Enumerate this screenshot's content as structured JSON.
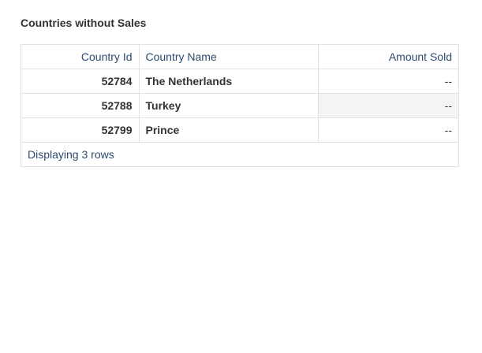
{
  "report": {
    "title": "Countries without Sales",
    "columns": {
      "country_id": "Country Id",
      "country_name": "Country Name",
      "amount_sold": "Amount Sold"
    },
    "rows": [
      {
        "country_id": "52784",
        "country_name": "The Netherlands",
        "amount_sold": "--"
      },
      {
        "country_id": "52788",
        "country_name": "Turkey",
        "amount_sold": "--"
      },
      {
        "country_id": "52799",
        "country_name": "Prince",
        "amount_sold": "--"
      }
    ],
    "footer": "Displaying 3 rows"
  },
  "colors": {
    "header_text": "#2d4a6e",
    "body_text": "#333333",
    "border": "#e2e2e2",
    "hover_cell": "#f4f4f5"
  }
}
